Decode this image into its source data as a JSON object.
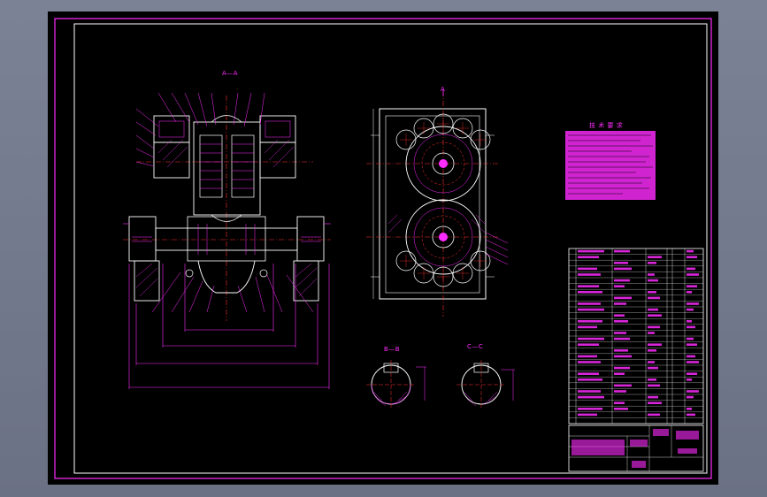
{
  "section_labels": {
    "main_view": "A—A",
    "top_marker": "A",
    "section_b": "B—B",
    "section_c": "C—C"
  },
  "notes": {
    "heading": "技 术 要 求"
  },
  "colors": {
    "background": "#000000",
    "frame": "#ff2cff",
    "lines": "#ffffff",
    "dimensions": "#ff2cff",
    "centerlines": "#ff3030",
    "sheet_surround": "#7c8296"
  }
}
